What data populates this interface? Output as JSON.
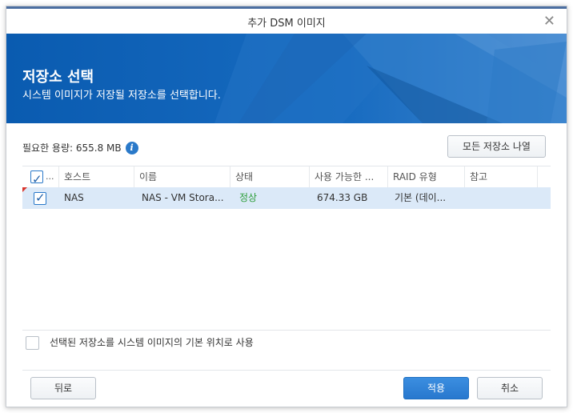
{
  "window": {
    "title": "추가 DSM 이미지",
    "close_glyph": "✕"
  },
  "banner": {
    "title": "저장소 선택",
    "subtitle": "시스템 이미지가 저장될 저장소를 선택합니다."
  },
  "required": {
    "label": "필요한 용량: 655.8 MB",
    "info_glyph": "i"
  },
  "list_all_button": "모든 저장소 나열",
  "table": {
    "select_all_label": "...",
    "columns": [
      "호스트",
      "이름",
      "상태",
      "사용 가능한 ...",
      "RAID 유형",
      "참고"
    ],
    "rows": [
      {
        "host": "NAS",
        "name": "NAS - VM Stora...",
        "status": "정상",
        "available": "674.33 GB",
        "raid": "기본 (데이...",
        "note": ""
      }
    ]
  },
  "default_checkbox_label": "선택된 저장소를 시스템 이미지의 기본 위치로 사용",
  "buttons": {
    "back": "뒤로",
    "apply": "적용",
    "cancel": "취소"
  },
  "colors": {
    "accent": "#2878ce",
    "banner": "#0f5fb0",
    "status_ok": "#2e9e3a",
    "row_selected": "#dbe9f8"
  }
}
